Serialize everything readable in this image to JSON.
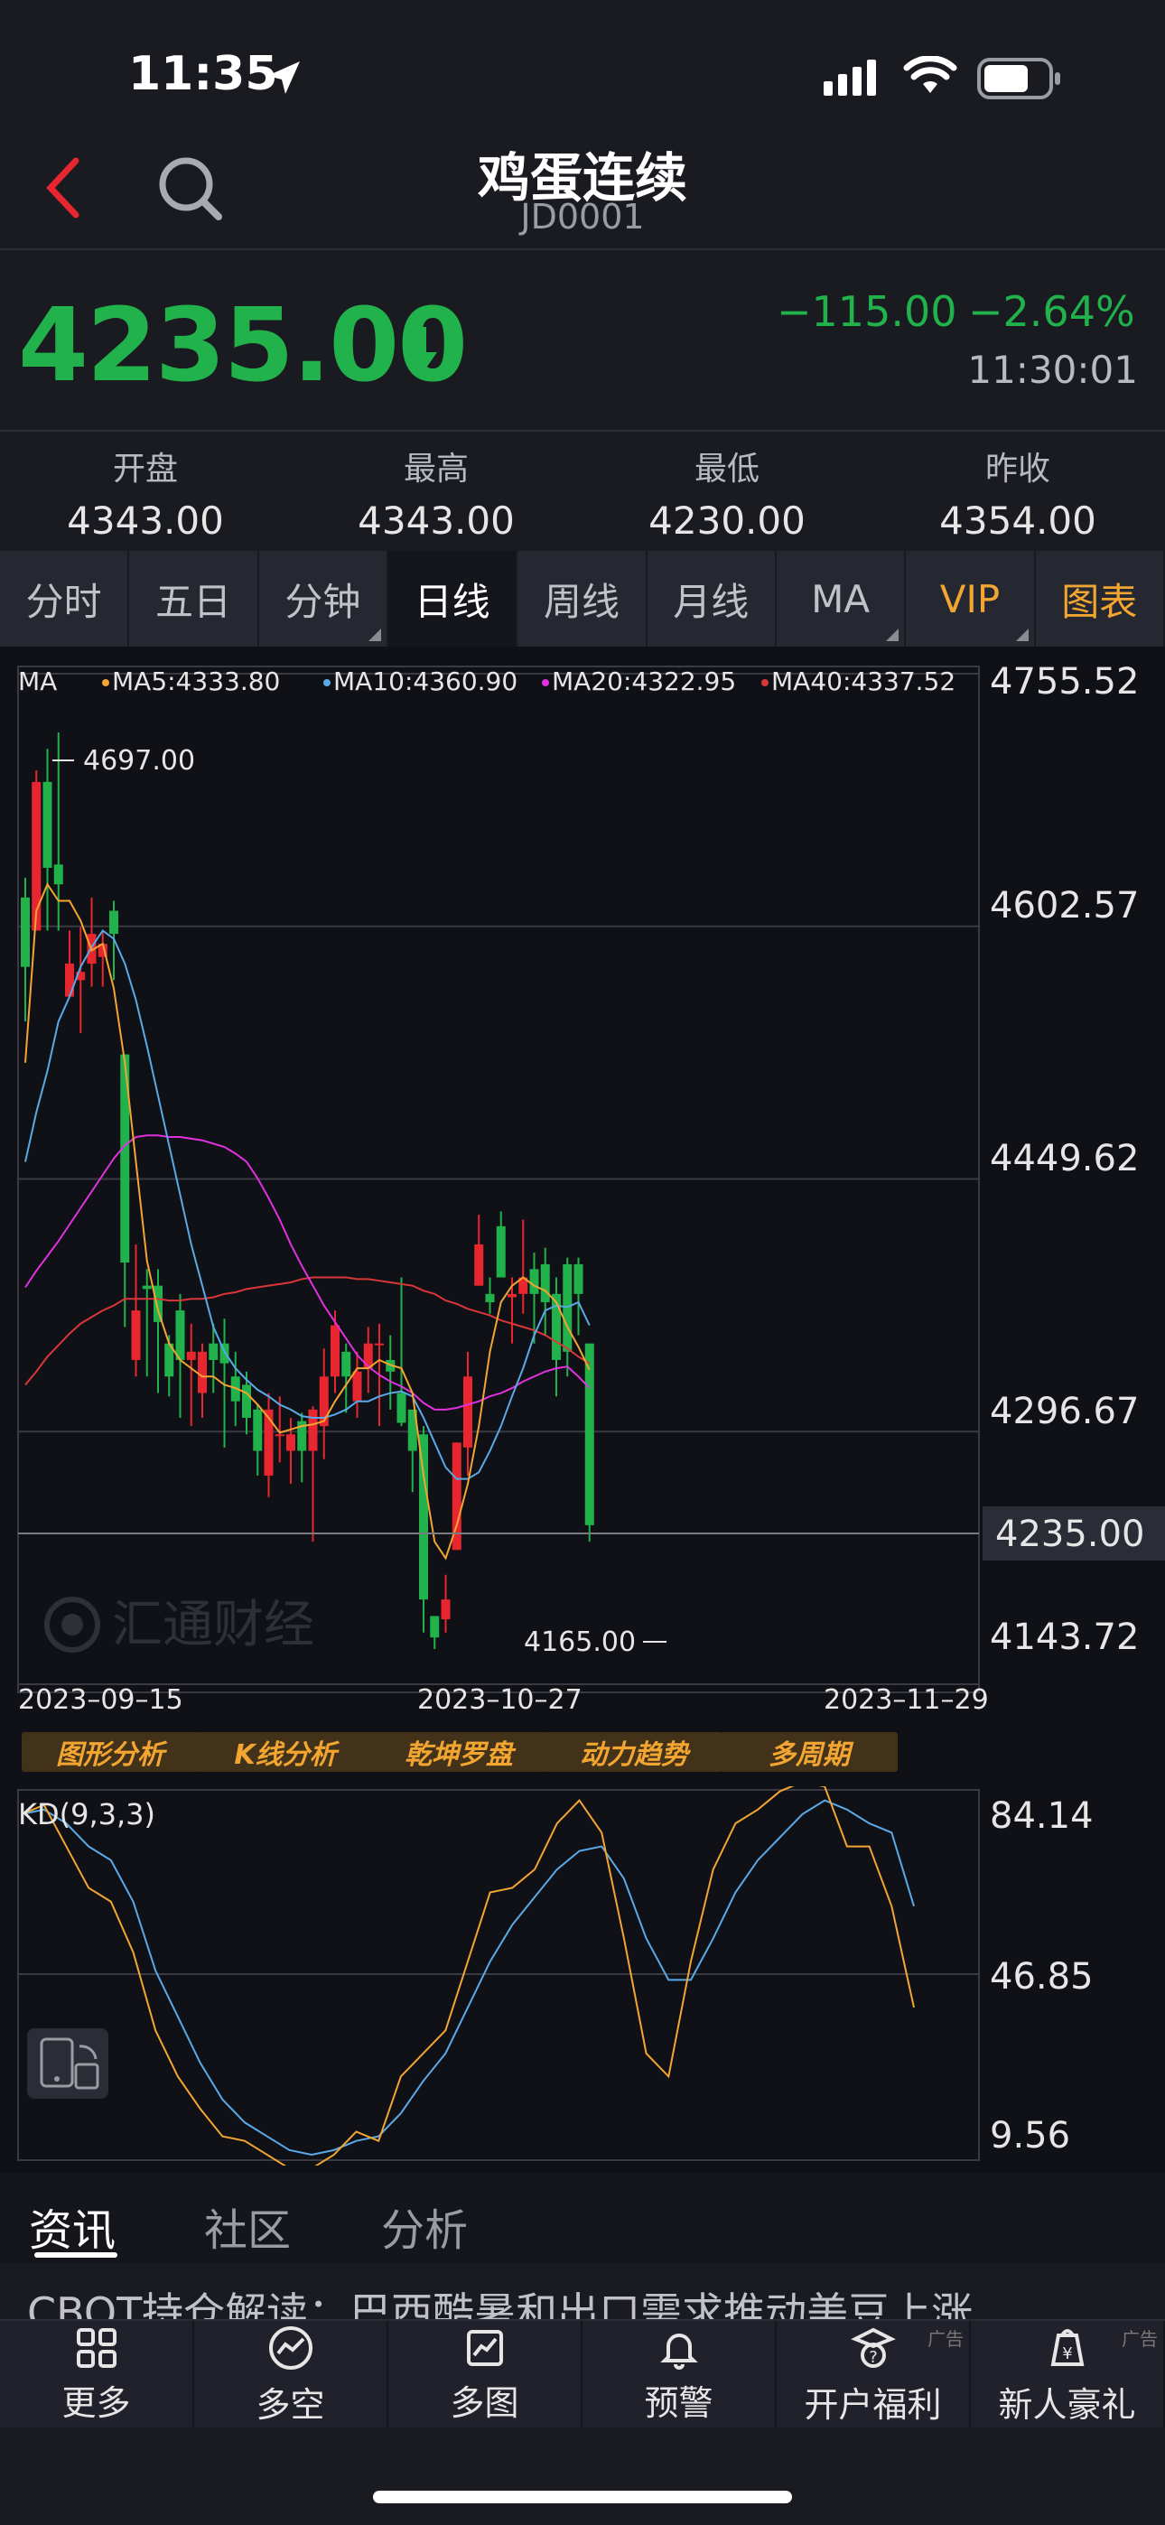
{
  "status_bar": {
    "time": "11:35"
  },
  "header": {
    "title": "鸡蛋连续",
    "code": "JD0001"
  },
  "quote": {
    "price": "4235.00",
    "change": "−115.00",
    "change_pct": "−2.64%",
    "time": "11:30:01"
  },
  "stats": [
    {
      "label": "开盘",
      "value": "4343.00"
    },
    {
      "label": "最高",
      "value": "4343.00"
    },
    {
      "label": "最低",
      "value": "4230.00"
    },
    {
      "label": "昨收",
      "value": "4354.00"
    }
  ],
  "tabs": [
    "分时",
    "五日",
    "分钟",
    "日线",
    "周线",
    "月线",
    "MA",
    "VIP",
    "图表"
  ],
  "active_tab": "日线",
  "ma_legend": {
    "prefix": "MA",
    "ma5": "MA5:4333.80",
    "ma10": "MA10:4360.90",
    "ma20": "MA20:4322.95",
    "ma40": "MA40:4337.52"
  },
  "price_axis": [
    "4755.52",
    "4602.57",
    "4449.62",
    "4296.67",
    "4143.72"
  ],
  "current_price_tag": "4235.00",
  "annotations": {
    "high": "4697.00",
    "low": "4165.00"
  },
  "watermark": "汇通财经",
  "dates": [
    "2023–09–15",
    "2023–10–27",
    "2023–11–29"
  ],
  "analysis_buttons": [
    "图形分析",
    "K线分析",
    "乾坤罗盘",
    "动力趋势",
    "多周期"
  ],
  "kd": {
    "label": "KD(9,3,3)",
    "axis": [
      "84.14",
      "46.85",
      "9.56"
    ]
  },
  "news_tabs": [
    "资讯",
    "社区",
    "分析"
  ],
  "headline": "CBOT持仓解读：巴西酷暑和出口需求推动美豆上涨",
  "bottom_nav": [
    {
      "label": "更多",
      "icon": "grid-icon",
      "ad": ""
    },
    {
      "label": "多空",
      "icon": "trend-icon",
      "ad": ""
    },
    {
      "label": "多图",
      "icon": "multi-chart-icon",
      "ad": ""
    },
    {
      "label": "预警",
      "icon": "bell-icon",
      "ad": ""
    },
    {
      "label": "开户福利",
      "icon": "account-icon",
      "ad": "广告"
    },
    {
      "label": "新人豪礼",
      "icon": "gift-icon",
      "ad": "广告"
    }
  ],
  "colors": {
    "up": "#e8262f",
    "down": "#21b24b",
    "ma5": "#f3a531",
    "ma10": "#5aa9e8",
    "ma20": "#e030e0",
    "ma40": "#d8373a"
  },
  "chart_data": {
    "type": "candlestick",
    "y_range": [
      4143.72,
      4755.52
    ],
    "candles": [
      [
        4620,
        4578,
        4632,
        4545
      ],
      [
        4600,
        4690,
        4697,
        4640
      ],
      [
        4690,
        4638,
        4710,
        4600
      ],
      [
        4640,
        4628,
        4720,
        4600
      ],
      [
        4560,
        4580,
        4600,
        4560
      ],
      [
        4570,
        4575,
        4602,
        4538
      ],
      [
        4580,
        4598,
        4620,
        4566
      ],
      [
        4584,
        4592,
        4600,
        4566
      ],
      [
        4612,
        4598,
        4618,
        4570
      ],
      [
        4525,
        4399,
        4525,
        4360
      ],
      [
        4340,
        4370,
        4410,
        4330
      ],
      [
        4385,
        4383,
        4395,
        4330
      ],
      [
        4385,
        4363,
        4395,
        4320
      ],
      [
        4350,
        4330,
        4355,
        4318
      ],
      [
        4370,
        4340,
        4380,
        4305
      ],
      [
        4340,
        4345,
        4362,
        4300
      ],
      [
        4320,
        4345,
        4350,
        4305
      ],
      [
        4350,
        4340,
        4362,
        4320
      ],
      [
        4350,
        4338,
        4365,
        4287
      ],
      [
        4330,
        4315,
        4345,
        4300
      ],
      [
        4325,
        4305,
        4333,
        4295
      ],
      [
        4310,
        4285,
        4313,
        4270
      ],
      [
        4270,
        4310,
        4320,
        4257
      ],
      [
        4295,
        4295,
        4318,
        4278
      ],
      [
        4285,
        4295,
        4305,
        4265
      ],
      [
        4303,
        4285,
        4308,
        4266
      ],
      [
        4285,
        4310,
        4312,
        4230
      ],
      [
        4300,
        4330,
        4347,
        4280
      ],
      [
        4330,
        4361,
        4370,
        4320
      ],
      [
        4345,
        4330,
        4350,
        4308
      ],
      [
        4315,
        4333,
        4345,
        4305
      ],
      [
        4335,
        4350,
        4360,
        4320
      ],
      [
        4350,
        4350,
        4362,
        4300
      ],
      [
        4340,
        4333,
        4355,
        4310
      ],
      [
        4320,
        4302,
        4390,
        4300
      ],
      [
        4310,
        4285,
        4300,
        4260
      ],
      [
        4295,
        4195,
        4300,
        4175
      ],
      [
        4185,
        4172,
        4182,
        4165
      ],
      [
        4183,
        4195,
        4210,
        4175
      ],
      [
        4225,
        4290,
        4290,
        4225
      ],
      [
        4287,
        4330,
        4345,
        4270
      ],
      [
        4385,
        4410,
        4428,
        4385
      ],
      [
        4380,
        4375,
        4390,
        4368
      ],
      [
        4421,
        4390,
        4430,
        4390
      ],
      [
        4378,
        4380,
        4390,
        4350
      ],
      [
        4380,
        4390,
        4425,
        4368
      ],
      [
        4395,
        4380,
        4405,
        4350
      ],
      [
        4398,
        4375,
        4408,
        4355
      ],
      [
        4380,
        4340,
        4390,
        4318
      ],
      [
        4398,
        4345,
        4402,
        4330
      ],
      [
        4398,
        4380,
        4402,
        4355
      ],
      [
        4350,
        4240,
        4350,
        4230
      ]
    ],
    "ma5": [
      4520,
      4612,
      4628,
      4618,
      4618,
      4606,
      4588,
      4592,
      4565,
      4520,
      4460,
      4400,
      4370,
      4350,
      4340,
      4335,
      4330,
      4330,
      4325,
      4323,
      4320,
      4313,
      4305,
      4296,
      4298,
      4300,
      4301,
      4303,
      4315,
      4325,
      4335,
      4335,
      4340,
      4337,
      4335,
      4320,
      4270,
      4230,
      4220,
      4240,
      4265,
      4300,
      4345,
      4375,
      4385,
      4390,
      4385,
      4382,
      4375,
      4360,
      4348,
      4334
    ],
    "ma10": [
      4460,
      4490,
      4515,
      4545,
      4560,
      4578,
      4590,
      4600,
      4595,
      4580,
      4558,
      4530,
      4500,
      4470,
      4440,
      4410,
      4385,
      4360,
      4345,
      4335,
      4328,
      4322,
      4318,
      4313,
      4310,
      4306,
      4305,
      4305,
      4307,
      4310,
      4315,
      4315,
      4318,
      4320,
      4321,
      4318,
      4305,
      4290,
      4275,
      4268,
      4268,
      4272,
      4285,
      4300,
      4318,
      4335,
      4355,
      4370,
      4373,
      4372,
      4375,
      4361
    ],
    "ma20": [
      4384,
      4394,
      4403,
      4412,
      4422,
      4432,
      4442,
      4452,
      4462,
      4470,
      4475,
      4476,
      4476,
      4475,
      4475,
      4474,
      4473,
      4471,
      4469,
      4465,
      4460,
      4450,
      4438,
      4425,
      4410,
      4397,
      4385,
      4373,
      4363,
      4353,
      4343,
      4336,
      4331,
      4327,
      4324,
      4320,
      4314,
      4310,
      4310,
      4311,
      4313,
      4315,
      4318,
      4320,
      4323,
      4327,
      4330,
      4333,
      4335,
      4336,
      4330,
      4323
    ],
    "ma40": [
      4325,
      4333,
      4342,
      4349,
      4356,
      4362,
      4366,
      4370,
      4373,
      4377,
      4377,
      4377,
      4377,
      4376,
      4376,
      4377,
      4377,
      4378,
      4380,
      4381,
      4383,
      4384,
      4385,
      4386,
      4387,
      4389,
      4390,
      4390,
      4390,
      4390,
      4389,
      4389,
      4388,
      4387,
      4386,
      4385,
      4382,
      4380,
      4376,
      4374,
      4371,
      4369,
      4367,
      4364,
      4362,
      4360,
      4358,
      4355,
      4351,
      4347,
      4342,
      4338
    ],
    "kd_k": [
      82,
      84,
      75,
      66,
      63,
      52,
      35,
      25,
      18,
      12,
      11,
      8,
      5,
      5,
      8,
      13,
      11,
      25,
      30,
      35,
      50,
      65,
      66,
      70,
      80,
      85,
      78,
      55,
      30,
      25,
      50,
      70,
      80,
      83,
      87,
      89,
      88,
      75,
      75,
      62,
      40
    ],
    "kd_d": [
      82,
      83,
      80,
      75,
      72,
      63,
      48,
      38,
      28,
      20,
      15,
      12,
      9,
      8,
      9,
      11,
      12,
      17,
      24,
      30,
      40,
      50,
      58,
      64,
      70,
      74,
      75,
      68,
      55,
      46,
      46,
      55,
      65,
      72,
      77,
      82,
      85,
      83,
      80,
      78,
      62
    ],
    "kd_range": [
      9.56,
      84.14
    ]
  }
}
